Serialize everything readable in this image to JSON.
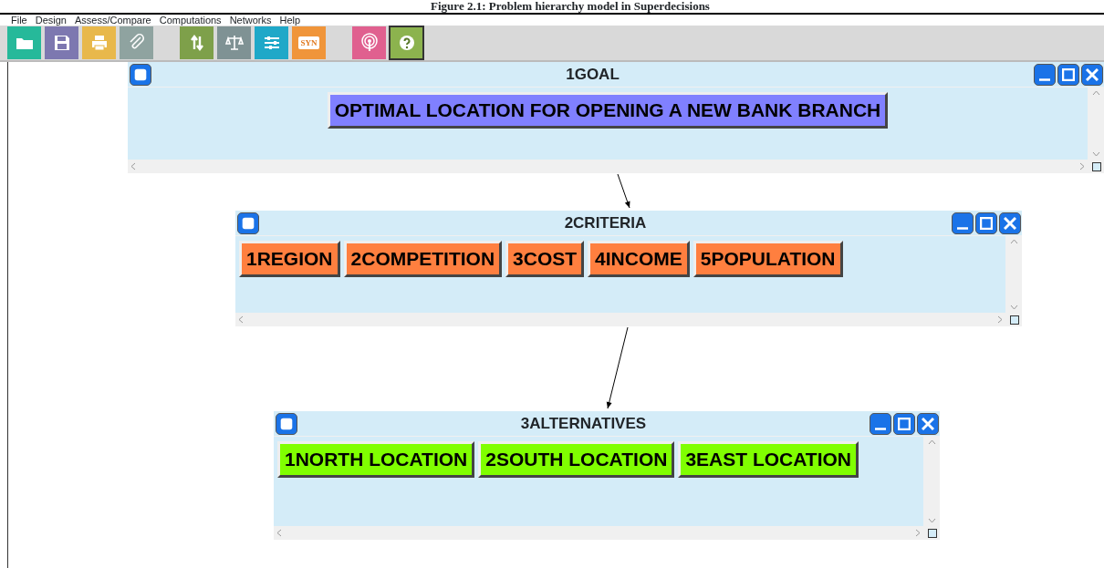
{
  "caption": "Figure 2.1: Problem hierarchy model in Superdecisions",
  "menu": [
    "File",
    "Design",
    "Assess/Compare",
    "Computations",
    "Networks",
    "Help"
  ],
  "toolbar": [
    [
      {
        "kind": "open",
        "selected": false
      },
      {
        "kind": "save",
        "selected": false
      },
      {
        "kind": "print",
        "selected": false
      },
      {
        "kind": "attach",
        "selected": false
      }
    ],
    [
      {
        "kind": "refresh",
        "selected": false
      },
      {
        "kind": "scale",
        "selected": false
      },
      {
        "kind": "sliders",
        "selected": false
      },
      {
        "kind": "text",
        "label": "SYN",
        "selected": false
      }
    ],
    [
      {
        "kind": "antenna",
        "selected": false
      },
      {
        "kind": "help",
        "selected": true
      }
    ]
  ],
  "clusters": [
    {
      "title": "1GOAL",
      "color": "#8080ff",
      "nodes": [
        "OPTIMAL LOCATION FOR OPENING A NEW BANK BRANCH"
      ]
    },
    {
      "title": "2CRITERIA",
      "color": "#ff7f3f",
      "nodes": [
        "1REGION",
        "2COMPETITION",
        "3COST",
        "4INCOME",
        "5POPULATION"
      ]
    },
    {
      "title": "3ALTERNATIVES",
      "color": "#80ff00",
      "nodes": [
        "1NORTH LOCATION",
        "2SOUTH LOCATION",
        "3EAST LOCATION"
      ]
    }
  ]
}
